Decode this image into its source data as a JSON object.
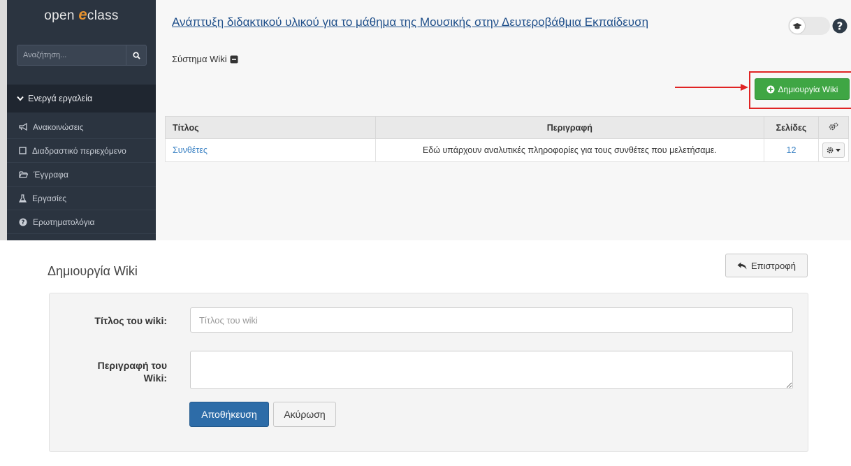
{
  "sidebar": {
    "logo_prefix": "open ",
    "logo_e": "e",
    "logo_suffix": "class",
    "search_placeholder": "Αναζήτηση...",
    "tools_header": "Ενεργά εργαλεία",
    "items": [
      {
        "label": "Ανακοινώσεις",
        "icon": "megaphone-icon"
      },
      {
        "label": "Διαδραστικό περιεχόμενο",
        "icon": "square-icon"
      },
      {
        "label": "Έγγραφα",
        "icon": "folder-open-icon"
      },
      {
        "label": "Εργασίες",
        "icon": "flask-icon"
      },
      {
        "label": "Ερωτηματολόγια",
        "icon": "question-circle-icon"
      }
    ]
  },
  "header": {
    "course_title": "Ανάπτυξη διδακτικού υλικού για το μάθημα της Μουσικής στην Δευτεροβάθμια Εκπαίδευση",
    "subtitle": "Σύστημα Wiki"
  },
  "toolbar": {
    "create_label": "Δημιουργία Wiki"
  },
  "table": {
    "headers": {
      "title": "Τίτλος",
      "description": "Περιγραφή",
      "pages": "Σελίδες"
    },
    "rows": [
      {
        "title": "Συνθέτες",
        "description": "Εδώ υπάρχουν αναλυτικές πληροφορίες για τους συνθέτες που μελετήσαμε.",
        "pages": "12"
      }
    ]
  },
  "form": {
    "title": "Δημιουργία Wiki",
    "back_label": "Επιστροφή",
    "title_label": "Τίτλος του wiki:",
    "title_placeholder": "Τίτλος του wiki",
    "desc_label_line1": "Περιγραφή του",
    "desc_label_line2": "Wiki:",
    "save_label": "Αποθήκευση",
    "cancel_label": "Ακύρωση"
  },
  "colors": {
    "sidebar_bg": "#2b3440",
    "accent_green": "#3fa644",
    "primary_blue": "#2d6ca8",
    "link_blue": "#3b82c4",
    "annotation_red": "#e02424",
    "logo_orange": "#e7922e"
  }
}
